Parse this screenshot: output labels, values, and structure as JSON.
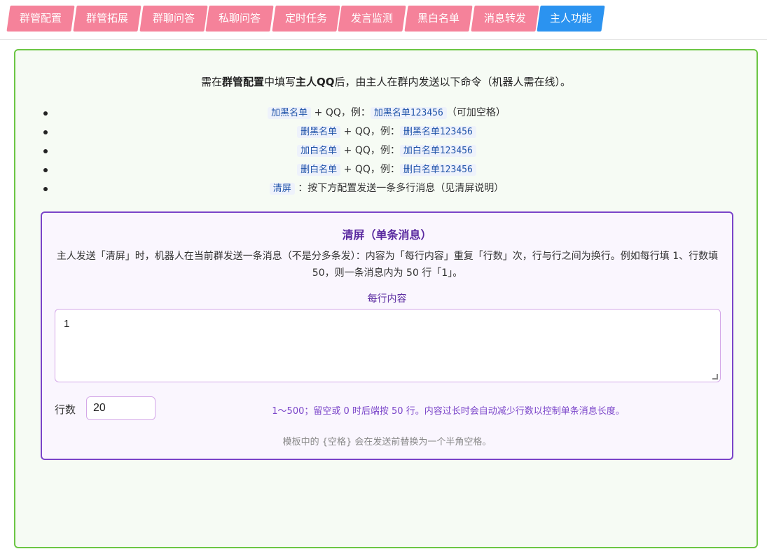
{
  "tabs": [
    {
      "label": "群管配置"
    },
    {
      "label": "群管拓展"
    },
    {
      "label": "群聊问答"
    },
    {
      "label": "私聊问答"
    },
    {
      "label": "定时任务"
    },
    {
      "label": "发言监测"
    },
    {
      "label": "黑白名单"
    },
    {
      "label": "消息转发"
    },
    {
      "label": "主人功能",
      "active": true
    }
  ],
  "intro": {
    "p1": "需在",
    "b1": "群管配置",
    "p2": "中填写",
    "b2": "主人QQ",
    "p3": "后，由主人在群内发送以下命令（机器人需在线）。"
  },
  "commands": [
    {
      "cmd": "加黑名单",
      "mid": " + QQ，例：",
      "example": "加黑名单123456",
      "suffix": "（可加空格）"
    },
    {
      "cmd": "删黑名单",
      "mid": " + QQ，例：",
      "example": "删黑名单123456",
      "suffix": ""
    },
    {
      "cmd": "加白名单",
      "mid": " + QQ，例：",
      "example": "加白名单123456",
      "suffix": ""
    },
    {
      "cmd": "删白名单",
      "mid": " + QQ，例：",
      "example": "删白名单123456",
      "suffix": ""
    },
    {
      "cmd": "清屏",
      "mid": " ：按下方配置发送一条多行消息（见清屏说明）",
      "example": "",
      "suffix": ""
    }
  ],
  "clear_screen": {
    "title": "清屏（单条消息）",
    "desc": "主人发送「清屏」时，机器人在当前群发送一条消息（不是分多条发）：内容为「每行内容」重复「行数」次，行与行之间为换行。例如每行填 1、行数填 50，则一条消息内为 50 行「1」。",
    "line_content_label": "每行内容",
    "line_content_value": "1",
    "rows_label": "行数",
    "rows_value": "20",
    "rows_hint": "1～500；留空或 0 时后端按 50 行。内容过长时会自动减少行数以控制单条消息长度。",
    "note": "模板中的 {空格} 会在发送前替换为一个半角空格。"
  }
}
